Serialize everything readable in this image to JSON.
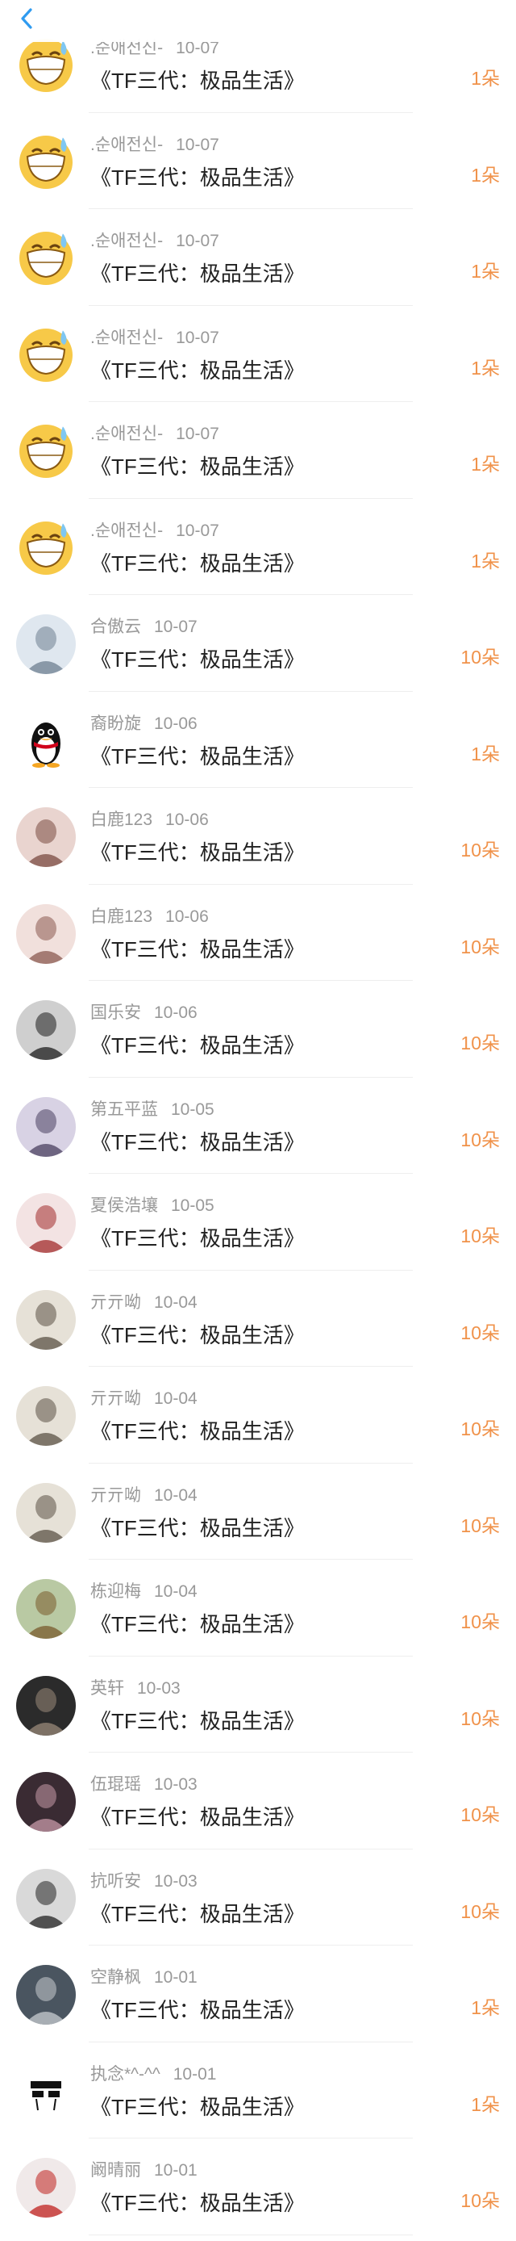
{
  "header": {
    "back_icon": "chevron-left-icon"
  },
  "colors": {
    "accent": "#f0924a",
    "back": "#2f9bf0"
  },
  "rows": [
    {
      "avatar": "grin-sweat-emoji",
      "name": ".순애전신-",
      "date": "10-07",
      "work": "《TF三代：极品生活》",
      "amount": "1朵"
    },
    {
      "avatar": "grin-sweat-emoji",
      "name": ".순애전신-",
      "date": "10-07",
      "work": "《TF三代：极品生活》",
      "amount": "1朵"
    },
    {
      "avatar": "grin-sweat-emoji",
      "name": ".순애전신-",
      "date": "10-07",
      "work": "《TF三代：极品生活》",
      "amount": "1朵"
    },
    {
      "avatar": "grin-sweat-emoji",
      "name": ".순애전신-",
      "date": "10-07",
      "work": "《TF三代：极品生活》",
      "amount": "1朵"
    },
    {
      "avatar": "grin-sweat-emoji",
      "name": ".순애전신-",
      "date": "10-07",
      "work": "《TF三代：极品生活》",
      "amount": "1朵"
    },
    {
      "avatar": "grin-sweat-emoji",
      "name": ".순애전신-",
      "date": "10-07",
      "work": "《TF三代：极品生活》",
      "amount": "1朵"
    },
    {
      "avatar": "photo",
      "name": "合傲云",
      "date": "10-07",
      "work": "《TF三代：极品生活》",
      "amount": "10朵"
    },
    {
      "avatar": "penguin",
      "name": "裔盼旋",
      "date": "10-06",
      "work": "《TF三代：极品生活》",
      "amount": "1朵"
    },
    {
      "avatar": "photo",
      "name": "白鹿123",
      "date": "10-06",
      "work": "《TF三代：极品生活》",
      "amount": "10朵"
    },
    {
      "avatar": "photo",
      "name": "白鹿123",
      "date": "10-06",
      "work": "《TF三代：极品生活》",
      "amount": "10朵"
    },
    {
      "avatar": "photo",
      "name": "国乐安",
      "date": "10-06",
      "work": "《TF三代：极品生活》",
      "amount": "10朵"
    },
    {
      "avatar": "photo",
      "name": "第五平蓝",
      "date": "10-05",
      "work": "《TF三代：极品生活》",
      "amount": "10朵"
    },
    {
      "avatar": "photo",
      "name": "夏侯浩壤",
      "date": "10-05",
      "work": "《TF三代：极品生活》",
      "amount": "10朵"
    },
    {
      "avatar": "photo",
      "name": "亓亓呦",
      "date": "10-04",
      "work": "《TF三代：极品生活》",
      "amount": "10朵"
    },
    {
      "avatar": "photo",
      "name": "亓亓呦",
      "date": "10-04",
      "work": "《TF三代：极品生活》",
      "amount": "10朵"
    },
    {
      "avatar": "photo",
      "name": "亓亓呦",
      "date": "10-04",
      "work": "《TF三代：极品生活》",
      "amount": "10朵"
    },
    {
      "avatar": "photo",
      "name": "栋迎梅",
      "date": "10-04",
      "work": "《TF三代：极品生活》",
      "amount": "10朵"
    },
    {
      "avatar": "photo",
      "name": "英轩",
      "date": "10-03",
      "work": "《TF三代：极品生活》",
      "amount": "10朵"
    },
    {
      "avatar": "photo",
      "name": "伍琨瑶",
      "date": "10-03",
      "work": "《TF三代：极品生活》",
      "amount": "10朵"
    },
    {
      "avatar": "photo",
      "name": "抗听安",
      "date": "10-03",
      "work": "《TF三代：极品生活》",
      "amount": "10朵"
    },
    {
      "avatar": "photo",
      "name": "空静枫",
      "date": "10-01",
      "work": "《TF三代：极品生活》",
      "amount": "1朵"
    },
    {
      "avatar": "fuck-sign",
      "name": "执念*^-^^",
      "date": "10-01",
      "work": "《TF三代：极品生活》",
      "amount": "1朵"
    },
    {
      "avatar": "photo",
      "name": "阚晴丽",
      "date": "10-01",
      "work": "《TF三代：极品生活》",
      "amount": "10朵"
    }
  ]
}
